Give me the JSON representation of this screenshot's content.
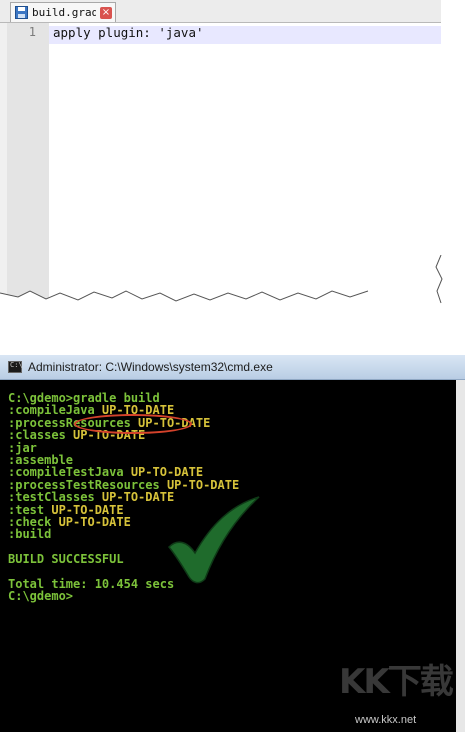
{
  "editor": {
    "tab": {
      "label": "build.gradle",
      "icon": "save-icon",
      "close_icon": "close-icon"
    },
    "lines": [
      {
        "number": "1",
        "text": "apply plugin: 'java'"
      }
    ]
  },
  "cmd": {
    "title": "Administrator: C:\\Windows\\system32\\cmd.exe",
    "lines": [
      {
        "text": "C:\\gdemo>gradle build",
        "status": ""
      },
      {
        "text": ":compileJava ",
        "status": "UP-TO-DATE"
      },
      {
        "text": ":processResources ",
        "status": "UP-TO-DATE"
      },
      {
        "text": ":classes ",
        "status": "UP-TO-DATE"
      },
      {
        "text": ":jar",
        "status": ""
      },
      {
        "text": ":assemble",
        "status": ""
      },
      {
        "text": ":compileTestJava ",
        "status": "UP-TO-DATE"
      },
      {
        "text": ":processTestResources ",
        "status": "UP-TO-DATE"
      },
      {
        "text": ":testClasses ",
        "status": "UP-TO-DATE"
      },
      {
        "text": ":test ",
        "status": "UP-TO-DATE"
      },
      {
        "text": ":check ",
        "status": "UP-TO-DATE"
      },
      {
        "text": ":build",
        "status": ""
      },
      {
        "text": "",
        "status": ""
      },
      {
        "text": "BUILD SUCCESSFUL",
        "status": ""
      },
      {
        "text": "",
        "status": ""
      },
      {
        "text": "Total time: 10.454 secs",
        "status": ""
      },
      {
        "text": "C:\\gdemo>",
        "status": ""
      }
    ]
  },
  "watermark": {
    "logo": "KK下载",
    "url": "www.kkx.net"
  },
  "colors": {
    "cmd_text": "#7cc23a",
    "cmd_status": "#d6c23a",
    "highlight_circle": "#d4422b",
    "checkmark": "#1f6b2c"
  }
}
